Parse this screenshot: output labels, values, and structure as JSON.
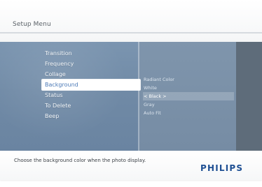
{
  "header": {
    "title": "Setup Menu"
  },
  "menu": {
    "items": [
      {
        "label": "Transition"
      },
      {
        "label": "Frequency"
      },
      {
        "label": "Collage"
      },
      {
        "label": "Background"
      },
      {
        "label": "Status"
      },
      {
        "label": "To Delete"
      },
      {
        "label": "Beep"
      }
    ],
    "selected_index": 3
  },
  "options": {
    "items": [
      {
        "label": "Radiant Color"
      },
      {
        "label": "White"
      },
      {
        "label": "< Black >"
      },
      {
        "label": "Gray"
      },
      {
        "label": "Auto Fit"
      }
    ],
    "current_index": 2
  },
  "footer": {
    "help_text": "Choose the background color when the photo display.",
    "brand": "PHILIPS"
  },
  "colors": {
    "accent": "#4b79b6",
    "brand": "#1e4f93",
    "menu_bg": "#708aa6",
    "selected_bg": "#ffffff"
  }
}
